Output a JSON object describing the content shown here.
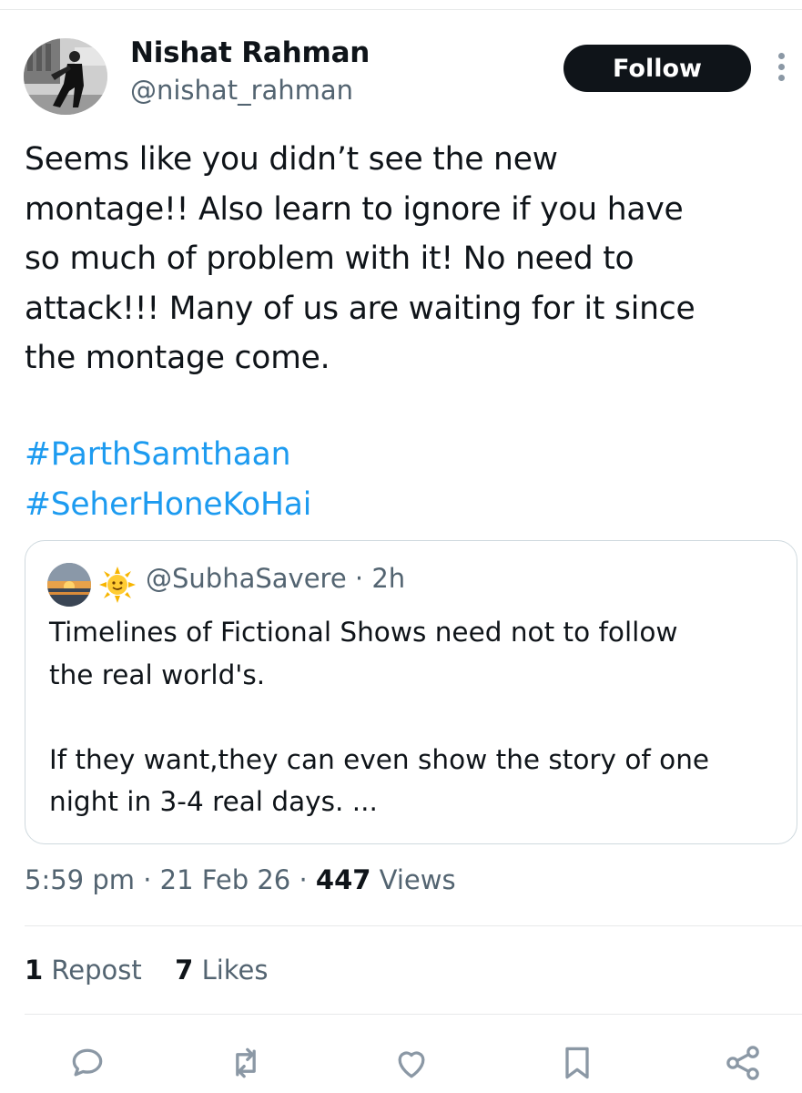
{
  "author": {
    "name": "Nishat Rahman",
    "handle": "@nishat_rahman",
    "follow_label": "Follow"
  },
  "tweet": {
    "text": "Seems like you didn’t see the new\nmontage!! Also learn to ignore if you have\nso much of problem with it! No need to\nattack!!! Many of us are waiting for it since\nthe montage come.",
    "hashtags": [
      "#ParthSamthaan",
      "#SeherHoneKoHai"
    ]
  },
  "quote": {
    "handle": "@SubhaSavere",
    "separator": "·",
    "age": "2h",
    "text": "Timelines of Fictional Shows need not to follow\nthe real world's.\n\nIf they want,they can even show the story of one\nnight in 3-4 real days. ..."
  },
  "meta": {
    "time": "5:59 pm",
    "date": "21 Feb 26",
    "separator": "·",
    "views_count": "447",
    "views_label": "Views"
  },
  "stats": {
    "reposts_count": "1",
    "reposts_label": "Repost",
    "likes_count": "7",
    "likes_label": "Likes"
  },
  "actions": [
    "reply-icon",
    "repost-icon",
    "like-icon",
    "bookmark-icon",
    "share-icon"
  ],
  "colors": {
    "text": "#0f1419",
    "secondary": "#536471",
    "link": "#1d9bf0",
    "button": "#0f1419",
    "border": "#cfd9de",
    "icon": "#8b98a5"
  }
}
